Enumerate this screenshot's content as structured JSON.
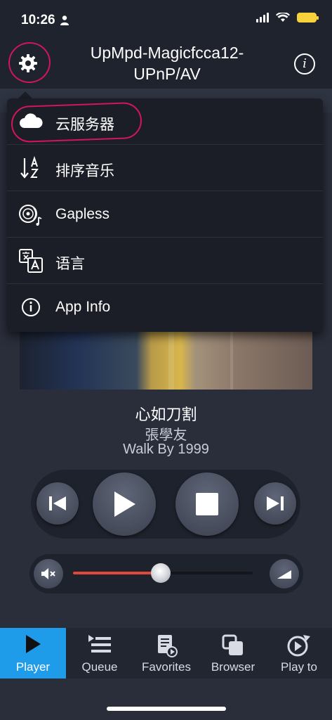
{
  "status_bar": {
    "time": "10:26"
  },
  "header": {
    "title": "UpMpd-Magicfcca12-UPnP/AV"
  },
  "menu": {
    "items": [
      {
        "label": "云服务器",
        "icon": "cloud-icon"
      },
      {
        "label": "排序音乐",
        "icon": "sort-az-icon"
      },
      {
        "label": "Gapless",
        "icon": "gapless-disc-icon"
      },
      {
        "label": "语言",
        "icon": "language-icon"
      },
      {
        "label": "App Info",
        "icon": "info-icon"
      }
    ]
  },
  "now_playing": {
    "title": "心如刀割",
    "artist": "張學友",
    "album": "Walk By 1999"
  },
  "volume": {
    "level": 0.49
  },
  "tabs": [
    {
      "label": "Player",
      "icon": "play-icon",
      "active": true
    },
    {
      "label": "Queue",
      "icon": "queue-icon",
      "active": false
    },
    {
      "label": "Favorites",
      "icon": "favorites-icon",
      "active": false
    },
    {
      "label": "Browser",
      "icon": "browser-icon",
      "active": false
    },
    {
      "label": "Play to",
      "icon": "play-to-icon",
      "active": false
    }
  ],
  "colors": {
    "accent": "#1e9be9",
    "annotation": "#d1165c",
    "volume_fill": "#e0483a"
  }
}
